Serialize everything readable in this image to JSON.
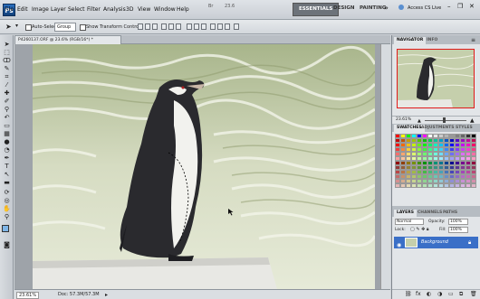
{
  "app": {
    "logo": "Ps",
    "zoom_label": "23.6",
    "cs_live": "Access CS Live"
  },
  "menu": [
    "File",
    "Edit",
    "Image",
    "Layer",
    "Select",
    "Filter",
    "Analysis",
    "3D",
    "View",
    "Window",
    "Help"
  ],
  "workspaces": [
    "ESSENTIALS",
    "DESIGN",
    "PAINTING"
  ],
  "options": {
    "auto_select_label": "Auto-Select:",
    "auto_select_value": "Group",
    "transform_label": "Show Transform Controls"
  },
  "document": {
    "tab_title": "P4260137.ORF @ 23.6% (RGB/16*) *",
    "zoom": "23.61%",
    "doc_size": "Doc: 57.3M/57.3M"
  },
  "panels": {
    "navigator_tabs": [
      "NAVIGATOR",
      "INFO"
    ],
    "navigator_zoom": "23.61%",
    "swatches_tabs": [
      "SWATCHES",
      "ADJUSTMENTS",
      "STYLES"
    ],
    "layers_tabs": [
      "LAYERS",
      "CHANNELS",
      "PATHS"
    ],
    "blend_mode": "Normal",
    "opacity_label": "Opacity:",
    "opacity": "100%",
    "lock_label": "Lock:",
    "fill_label": "Fill:",
    "fill": "100%",
    "layer_name": "Background"
  },
  "colors": {
    "accent": "#3a6fc7",
    "nav_frame": "#e11a1a"
  }
}
